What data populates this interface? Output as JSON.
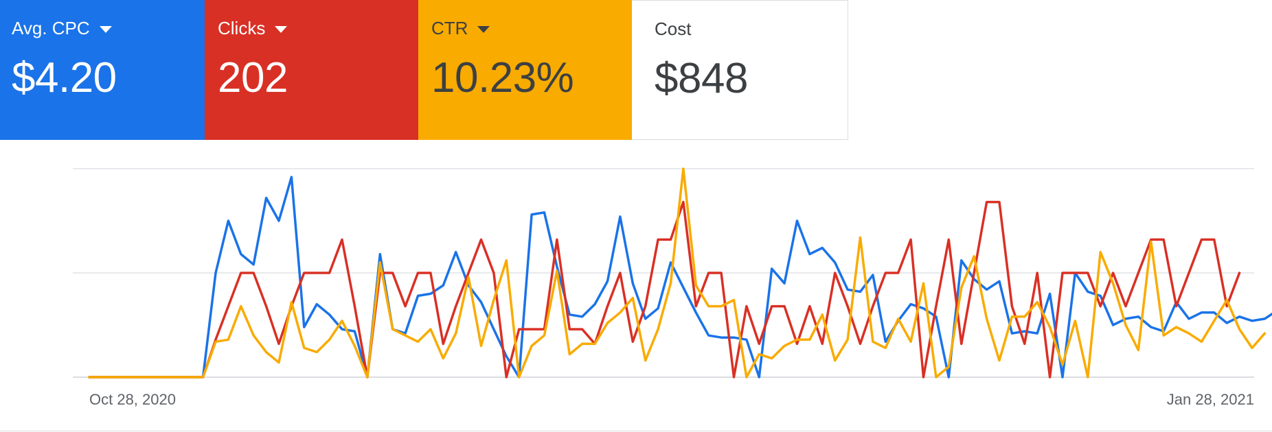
{
  "cards": [
    {
      "label": "Avg. CPC",
      "value": "$4.20",
      "has_dropdown": true,
      "color": "#1a73e8"
    },
    {
      "label": "Clicks",
      "value": "202",
      "has_dropdown": true,
      "color": "#d93025"
    },
    {
      "label": "CTR",
      "value": "10.23%",
      "has_dropdown": true,
      "color": "#f9ab00"
    },
    {
      "label": "Cost",
      "value": "$848",
      "has_dropdown": false,
      "color": "#ffffff"
    }
  ],
  "chart_data": {
    "type": "line",
    "xlabels": [
      "Oct 28, 2020",
      "Jan 28, 2021"
    ],
    "x": [
      "2020-10-28",
      "2020-10-29",
      "2020-10-30",
      "2020-10-31",
      "2020-11-01",
      "2020-11-02",
      "2020-11-03",
      "2020-11-04",
      "2020-11-05",
      "2020-11-06",
      "2020-11-07",
      "2020-11-08",
      "2020-11-09",
      "2020-11-10",
      "2020-11-11",
      "2020-11-12",
      "2020-11-13",
      "2020-11-14",
      "2020-11-15",
      "2020-11-16",
      "2020-11-17",
      "2020-11-18",
      "2020-11-19",
      "2020-11-20",
      "2020-11-21",
      "2020-11-22",
      "2020-11-23",
      "2020-11-24",
      "2020-11-25",
      "2020-11-26",
      "2020-11-27",
      "2020-11-28",
      "2020-11-29",
      "2020-11-30",
      "2020-12-01",
      "2020-12-02",
      "2020-12-03",
      "2020-12-04",
      "2020-12-05",
      "2020-12-06",
      "2020-12-07",
      "2020-12-08",
      "2020-12-09",
      "2020-12-10",
      "2020-12-11",
      "2020-12-12",
      "2020-12-13",
      "2020-12-14",
      "2020-12-15",
      "2020-12-16",
      "2020-12-17",
      "2020-12-18",
      "2020-12-19",
      "2020-12-20",
      "2020-12-21",
      "2020-12-22",
      "2020-12-23",
      "2020-12-24",
      "2020-12-25",
      "2020-12-26",
      "2020-12-27",
      "2020-12-28",
      "2020-12-29",
      "2020-12-30",
      "2020-12-31",
      "2021-01-01",
      "2021-01-02",
      "2021-01-03",
      "2021-01-04",
      "2021-01-05",
      "2021-01-06",
      "2021-01-07",
      "2021-01-08",
      "2021-01-09",
      "2021-01-10",
      "2021-01-11",
      "2021-01-12",
      "2021-01-13",
      "2021-01-14",
      "2021-01-15",
      "2021-01-16",
      "2021-01-17",
      "2021-01-18",
      "2021-01-19",
      "2021-01-20",
      "2021-01-21",
      "2021-01-22",
      "2021-01-23",
      "2021-01-24",
      "2021-01-25",
      "2021-01-26",
      "2021-01-27",
      "2021-01-28"
    ],
    "ylim": [
      0,
      100
    ],
    "gridlines": 3,
    "series": [
      {
        "color": "#1a73e8",
        "values": [
          0,
          0,
          0,
          0,
          0,
          0,
          0,
          0,
          0,
          0,
          50,
          75,
          59,
          54,
          86,
          75,
          96,
          24,
          35,
          30,
          23,
          22,
          0,
          59,
          23,
          21,
          39,
          40,
          44,
          60,
          44,
          36,
          23,
          10,
          0,
          78,
          79,
          53,
          30,
          29,
          35,
          46,
          77,
          45,
          28,
          33,
          55,
          43,
          31,
          20,
          19,
          19,
          18,
          0,
          52,
          45,
          75,
          59,
          62,
          55,
          42,
          41,
          49,
          17,
          27,
          35,
          33,
          29,
          0,
          56,
          47,
          42,
          46,
          21,
          22,
          21,
          40,
          0,
          50,
          41,
          39,
          25,
          28,
          29,
          24,
          22,
          36,
          28,
          31,
          31,
          26,
          29,
          27,
          28,
          32
        ]
      },
      {
        "color": "#d93025",
        "values": [
          0,
          0,
          0,
          0,
          0,
          0,
          0,
          0,
          0,
          0,
          18,
          34,
          50,
          50,
          34,
          16,
          34,
          50,
          50,
          50,
          66,
          34,
          0,
          50,
          50,
          34,
          50,
          50,
          16,
          34,
          50,
          66,
          50,
          0,
          23,
          23,
          23,
          66,
          23,
          23,
          16,
          34,
          50,
          17,
          34,
          66,
          66,
          84,
          34,
          50,
          50,
          0,
          34,
          16,
          34,
          34,
          16,
          34,
          16,
          50,
          34,
          16,
          34,
          50,
          50,
          66,
          0,
          34,
          66,
          16,
          50,
          84,
          84,
          34,
          16,
          50,
          0,
          50,
          50,
          50,
          34,
          50,
          34,
          50,
          66,
          66,
          34,
          50,
          66,
          66,
          34,
          50
        ]
      },
      {
        "color": "#f9ab00",
        "values": [
          0,
          0,
          0,
          0,
          0,
          0,
          0,
          0,
          0,
          0,
          17,
          18,
          34,
          20,
          12,
          7,
          36,
          14,
          12,
          18,
          27,
          15,
          0,
          55,
          23,
          20,
          17,
          23,
          9,
          21,
          48,
          15,
          37,
          56,
          0,
          15,
          20,
          51,
          11,
          16,
          16,
          26,
          31,
          38,
          8,
          23,
          45,
          100,
          44,
          34,
          34,
          37,
          0,
          11,
          9,
          15,
          18,
          18,
          30,
          8,
          18,
          67,
          17,
          14,
          28,
          17,
          45,
          0,
          5,
          43,
          58,
          28,
          8,
          29,
          29,
          36,
          24,
          6,
          27,
          0,
          60,
          45,
          25,
          13,
          65,
          20,
          24,
          21,
          17,
          27,
          37,
          23,
          14,
          21
        ]
      }
    ]
  }
}
